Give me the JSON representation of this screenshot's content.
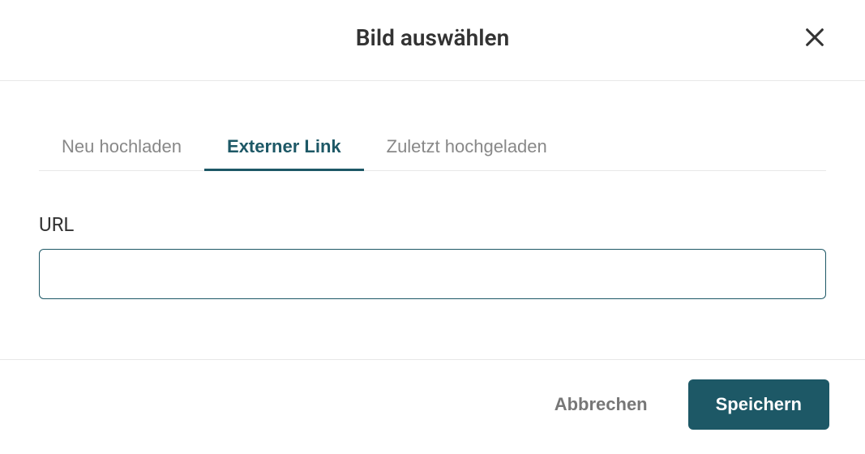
{
  "header": {
    "title": "Bild auswählen"
  },
  "tabs": {
    "upload": "Neu hochladen",
    "external": "Externer Link",
    "recent": "Zuletzt hochgeladen"
  },
  "form": {
    "url_label": "URL",
    "url_value": ""
  },
  "footer": {
    "cancel": "Abbrechen",
    "save": "Speichern"
  }
}
